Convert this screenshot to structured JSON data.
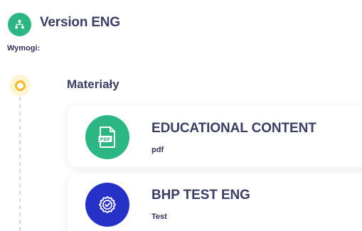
{
  "header": {
    "title": "Version ENG",
    "icon": "sitemap-icon",
    "icon_color": "#2bb683"
  },
  "requirements_label": "Wymogi:",
  "timeline": {
    "node_color": "#f7b926",
    "section_title": "Materiały"
  },
  "materials": [
    {
      "title": "EDUCATIONAL CONTENT",
      "type": "pdf",
      "icon": "pdf-file-icon",
      "icon_color": "#2bb683"
    },
    {
      "title": "BHP TEST ENG",
      "type": "Test",
      "icon": "badge-check-icon",
      "icon_color": "#2531c7"
    }
  ]
}
